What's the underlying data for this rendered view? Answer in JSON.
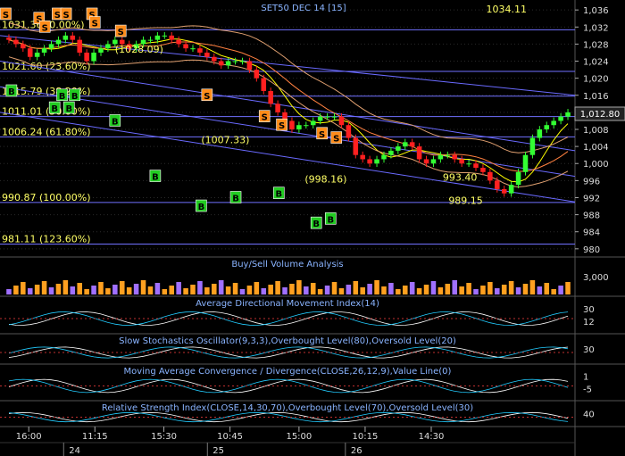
{
  "chart_data": {
    "type": "candlestick",
    "title": "SET50 DEC 14   [15]",
    "last_value_top": "1034.11",
    "current_price_tag": "1,012.80",
    "colors": {
      "background": "#000000",
      "up": "#33ff33",
      "down": "#ff2020",
      "fib": "#7070ff",
      "trend": "#6a6aff",
      "bb": "#e0a070",
      "ma_short": "#ffff00",
      "ma_long": "#ff8040",
      "grid": "#2a2a2a",
      "axis_text": "#dddddd",
      "label_yellow": "#ffff66"
    },
    "price_axis": {
      "ticks": [
        "1,036",
        "1,032",
        "1,028",
        "1,024",
        "1,020",
        "1,016",
        "1,012",
        "1,008",
        "1,004",
        "1,000",
        "996",
        "992",
        "988",
        "984",
        "980"
      ],
      "tick_values": [
        1036,
        1032,
        1028,
        1024,
        1020,
        1016,
        1012,
        1008,
        1004,
        1000,
        996,
        992,
        988,
        984,
        980
      ],
      "ylim": [
        978.5,
        1037.5
      ]
    },
    "fib_levels": [
      {
        "price": 1031.36,
        "label": "1031.36 (0.00%)"
      },
      {
        "price": 1021.6,
        "label": "1021.60 (23.60%)"
      },
      {
        "price": 1015.79,
        "label": "1015.79 (38.20%)"
      },
      {
        "price": 1011.01,
        "label": "1011.01 (50.00%)"
      },
      {
        "price": 1006.24,
        "label": "1006.24 (61.80%)"
      },
      {
        "price": 990.87,
        "label": "990.87 (100.00%)"
      },
      {
        "price": 981.11,
        "label": "981.11 (123.60%)"
      }
    ],
    "annotations": [
      {
        "text": "(1028.09)",
        "price": 1026.0,
        "t": 0.2
      },
      {
        "text": "(1007.33)",
        "price": 1004.8,
        "t": 0.35
      },
      {
        "text": "(998.16)",
        "price": 995.6,
        "t": 0.53
      },
      {
        "text": "993.40",
        "price": 996.0,
        "t": 0.77
      },
      {
        "text": "989.15",
        "price": 990.5,
        "t": 0.78
      }
    ],
    "time_ticks": [
      {
        "label": "16:00",
        "t": 0.05
      },
      {
        "label": "11:15",
        "t": 0.165
      },
      {
        "label": "15:30",
        "t": 0.285
      },
      {
        "label": "10:45",
        "t": 0.4
      },
      {
        "label": "15:00",
        "t": 0.52
      },
      {
        "label": "10:15",
        "t": 0.635
      },
      {
        "label": "14:30",
        "t": 0.75
      }
    ],
    "day_ticks": [
      {
        "label": "24",
        "t": 0.12
      },
      {
        "label": "25",
        "t": 0.37
      },
      {
        "label": "26",
        "t": 0.61
      }
    ],
    "candles_close": [
      1029,
      1028,
      1027,
      1025,
      1026,
      1027,
      1028,
      1029,
      1030,
      1029,
      1026,
      1024,
      1026,
      1027,
      1028,
      1029,
      1028,
      1027,
      1028,
      1029,
      1029,
      1030,
      1030,
      1029,
      1028,
      1027,
      1027,
      1026,
      1025,
      1024,
      1023,
      1024,
      1024,
      1024,
      1022,
      1020,
      1017,
      1014,
      1012,
      1010,
      1008,
      1009,
      1009,
      1010,
      1011,
      1011,
      1011,
      1009,
      1006,
      1002,
      1001,
      1000,
      1001,
      1002,
      1003,
      1004,
      1005,
      1004,
      1001,
      1000,
      1001,
      1002,
      1002,
      1001,
      1000,
      1000,
      999,
      998,
      996,
      994,
      993,
      995,
      998,
      1002,
      1006,
      1008,
      1009,
      1010,
      1011,
      1012
    ],
    "signals": [
      {
        "type": "S",
        "t": 0.01,
        "price": 1035
      },
      {
        "type": "B",
        "t": 0.02,
        "price": 1017
      },
      {
        "type": "S",
        "t": 0.068,
        "price": 1034
      },
      {
        "type": "S",
        "t": 0.078,
        "price": 1032
      },
      {
        "type": "B",
        "t": 0.095,
        "price": 1013
      },
      {
        "type": "S",
        "t": 0.1,
        "price": 1035
      },
      {
        "type": "S",
        "t": 0.115,
        "price": 1035
      },
      {
        "type": "B",
        "t": 0.108,
        "price": 1016
      },
      {
        "type": "B",
        "t": 0.12,
        "price": 1013
      },
      {
        "type": "B",
        "t": 0.13,
        "price": 1016
      },
      {
        "type": "S",
        "t": 0.16,
        "price": 1035
      },
      {
        "type": "S",
        "t": 0.165,
        "price": 1033
      },
      {
        "type": "B",
        "t": 0.2,
        "price": 1010
      },
      {
        "type": "S",
        "t": 0.21,
        "price": 1031
      },
      {
        "type": "B",
        "t": 0.27,
        "price": 997
      },
      {
        "type": "B",
        "t": 0.35,
        "price": 990
      },
      {
        "type": "S",
        "t": 0.36,
        "price": 1016
      },
      {
        "type": "B",
        "t": 0.41,
        "price": 992
      },
      {
        "type": "S",
        "t": 0.46,
        "price": 1011
      },
      {
        "type": "S",
        "t": 0.49,
        "price": 1009
      },
      {
        "type": "B",
        "t": 0.485,
        "price": 993
      },
      {
        "type": "B",
        "t": 0.55,
        "price": 986
      },
      {
        "type": "S",
        "t": 0.56,
        "price": 1007
      },
      {
        "type": "B",
        "t": 0.575,
        "price": 987
      },
      {
        "type": "S",
        "t": 0.585,
        "price": 1006
      }
    ],
    "indicators": [
      {
        "title": "Buy/Sell Volume Analysis",
        "ticks": [
          "3,000"
        ]
      },
      {
        "title": "Average Directional Movement Index(14)",
        "ticks": [
          "30",
          "12"
        ]
      },
      {
        "title": "Slow Stochastics Oscillator(9,3,3),Overbought Level(80),Oversold Level(20)",
        "ticks": [
          "30"
        ]
      },
      {
        "title": "Moving Average Convergence / Divergence(CLOSE,26,12,9),Value Line(0)",
        "ticks": [
          "1",
          "-5"
        ]
      },
      {
        "title": "Relative Strength Index(CLOSE,14,30,70),Overbought Level(70),Oversold Level(30)",
        "ticks": [
          "40"
        ]
      }
    ]
  }
}
